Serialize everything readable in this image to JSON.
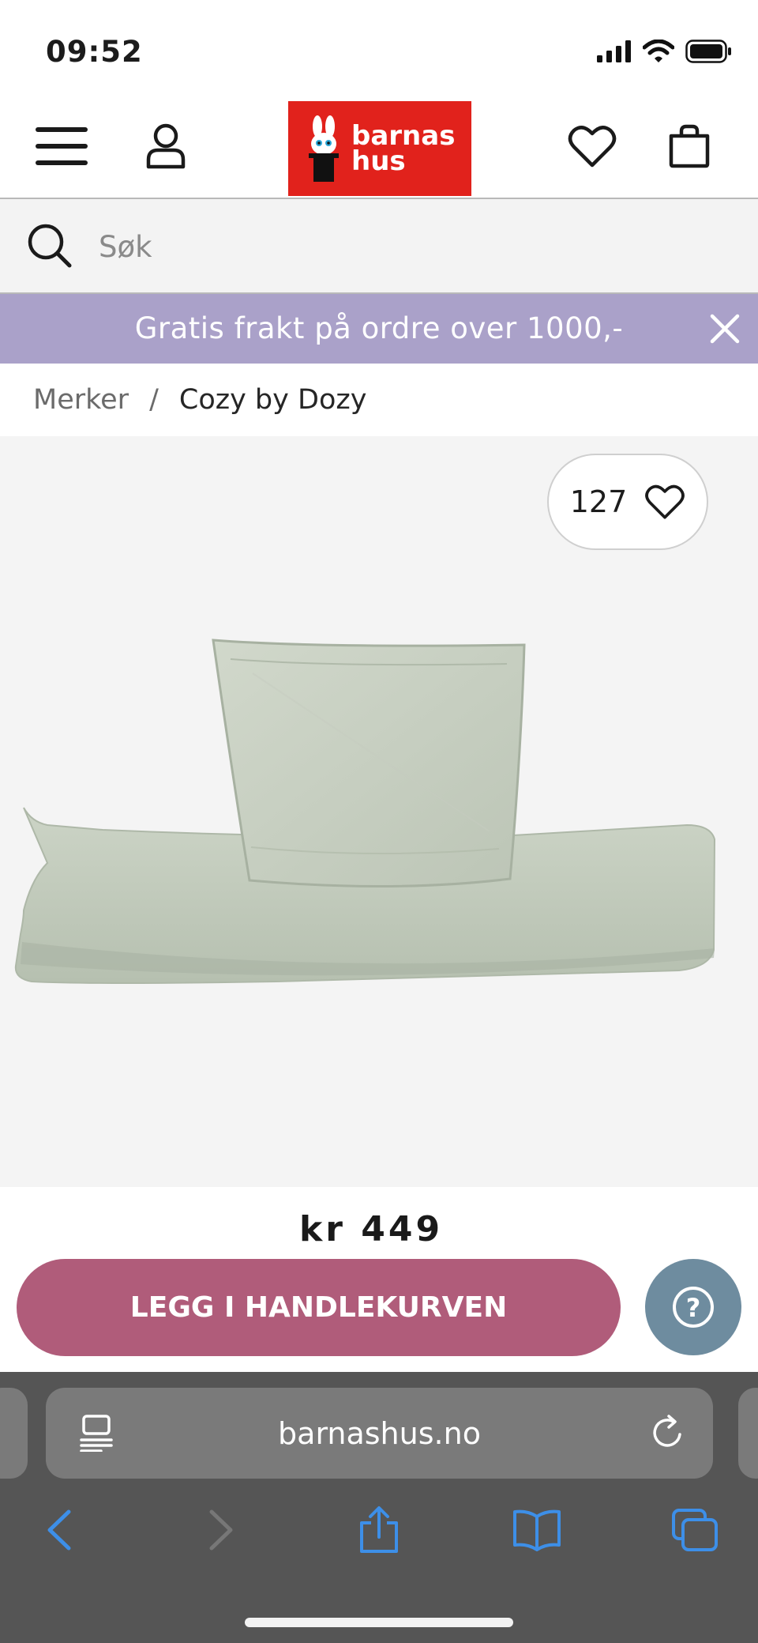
{
  "status": {
    "time": "09:52"
  },
  "header": {
    "logo_line1": "barnas",
    "logo_line2": "hus"
  },
  "search": {
    "placeholder": "Søk"
  },
  "promo": {
    "text": "Gratis frakt på ordre over 1000,-"
  },
  "breadcrumb": {
    "parent": "Merker",
    "separator": "/",
    "current": "Cozy by Dozy"
  },
  "product": {
    "favorites_count": "127",
    "price": "kr 449"
  },
  "actions": {
    "add_to_cart": "LEGG I HANDLEKURVEN",
    "help": "?"
  },
  "browser": {
    "url": "barnashus.no"
  },
  "colors": {
    "logo_bg": "#e1221c",
    "promo_bg": "#aaa1c9",
    "cart_button": "#b05c7a",
    "help_button": "#6e8c9f",
    "safari_blue": "#3d8fe8"
  },
  "icons": [
    "menu-icon",
    "account-icon",
    "heart-icon",
    "bag-icon",
    "search-icon",
    "close-icon",
    "reader-icon",
    "reload-icon",
    "back-icon",
    "forward-icon",
    "share-icon",
    "bookmarks-icon",
    "tabs-icon"
  ]
}
